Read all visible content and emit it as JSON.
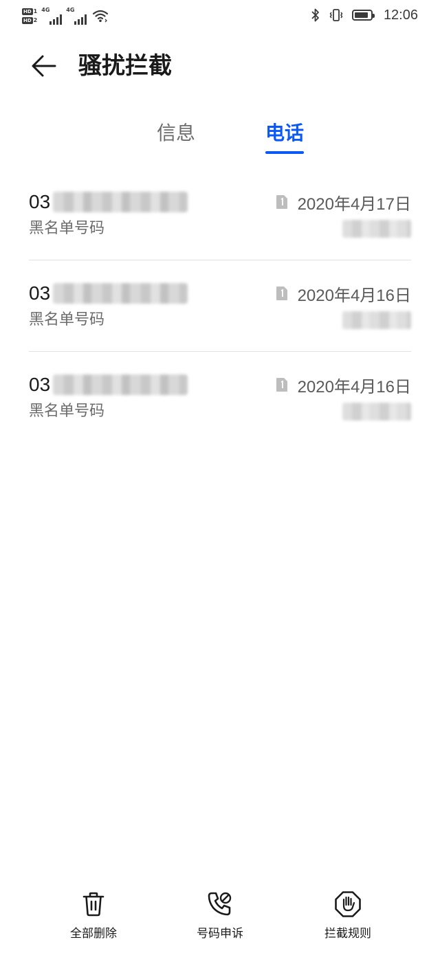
{
  "status_bar": {
    "sim1_badge": "HD",
    "sim1_num": "1",
    "sim2_badge": "HD",
    "sim2_num": "2",
    "net1": "4G",
    "net2": "4G",
    "time": "12:06",
    "battery_percent": 85,
    "icons": [
      "wifi-icon",
      "bluetooth-icon",
      "vibrate-icon",
      "battery-icon"
    ]
  },
  "header": {
    "title": "骚扰拦截",
    "back_icon": "arrow-left-icon"
  },
  "tabs": [
    {
      "label": "信息",
      "active": false
    },
    {
      "label": "电话",
      "active": true
    }
  ],
  "calls": [
    {
      "number_prefix": "03",
      "type": "黑名单号码",
      "date": "2020年4月17日",
      "sim_icon": "sim-1-icon"
    },
    {
      "number_prefix": "03",
      "type": "黑名单号码",
      "date": "2020年4月16日",
      "sim_icon": "sim-1-icon"
    },
    {
      "number_prefix": "03",
      "type": "黑名单号码",
      "date": "2020年4月16日",
      "sim_icon": "sim-1-icon"
    }
  ],
  "toolbar": {
    "delete_all": "全部删除",
    "number_appeal": "号码申诉",
    "block_rules": "拦截规则"
  },
  "colors": {
    "accent": "#0a59f7",
    "text_primary": "#1a1a1a",
    "text_secondary": "#6b6b6b",
    "divider": "#e2e2e2"
  }
}
